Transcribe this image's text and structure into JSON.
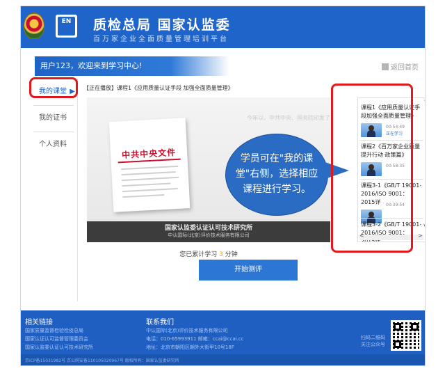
{
  "header": {
    "title": "质检总局   国家认监委",
    "subtitle": "百万家企业全面质量管理培训平台",
    "logo_text": "EN"
  },
  "welcome": {
    "text": "用户123，欢迎来到学习中心!",
    "home_link": "返回首页"
  },
  "sidebar": {
    "items": [
      {
        "label": "我的课堂",
        "active": true
      },
      {
        "label": "我的证书",
        "active": false
      },
      {
        "label": "个人资料",
        "active": false
      }
    ],
    "active_arrow": "▶"
  },
  "player": {
    "now_playing": "【正在播放】课程1《应用质量认证手段 加强全面质量管理》",
    "faint_caption": "今年以，中共中央、国务院印发了《关于",
    "doc_title": "中共中央文件",
    "footer_line1": "国家认监委认证认可技术研究所",
    "footer_line2": "中认国际(北京)评价技术服务有限公司"
  },
  "callout": {
    "text": "学员可在\"我的课堂\"右侧，选择相应课程进行学习。"
  },
  "courses": [
    {
      "title": "课程1《应用质量认证手段加强全面质量管理》",
      "duration": "00:54:49",
      "status": "正在学习"
    },
    {
      "title": "课程2《百万家企业质量提升行动·政策篇》",
      "duration": "00:58:35",
      "status": ""
    },
    {
      "title": "课程3-1《GB/T 19001-2016/ISO 9001：2015详",
      "duration": "00:39:54",
      "status": ""
    },
    {
      "title": "课程3-2《GB/T 19001-2016/ISO 9001：2015详",
      "duration": "",
      "status": ""
    }
  ],
  "course_nav": {
    "up": "^",
    "down": "v",
    "left": "<",
    "right": ">"
  },
  "study": {
    "prefix": "您已累计学习",
    "minutes": "3",
    "suffix": "分钟",
    "start_button": "开始测评"
  },
  "footer": {
    "links_heading": "相关链接",
    "links": [
      "国家质量监督检验检疫总局",
      "国家认证认可监督管理委员会",
      "国家认监委认证认可技术研究所"
    ],
    "contact_heading": "联系我们",
    "contact": [
      "中认国际(北京)评价技术服务有限公司",
      "电话：010-65993911    邮箱：ccai@ccai.cc",
      "地址：北京市朝阳区朝外大街甲10号18F"
    ],
    "qr_caption": "扫码二维码\n关注公众号",
    "copyright": "京ICP备15031982号  京公网安备110105020967号   版权所有：国家认监委研究所"
  },
  "colors": {
    "brand_blue": "#1f64c8",
    "highlight_red": "#e0191e",
    "accent_orange": "#f39800"
  }
}
